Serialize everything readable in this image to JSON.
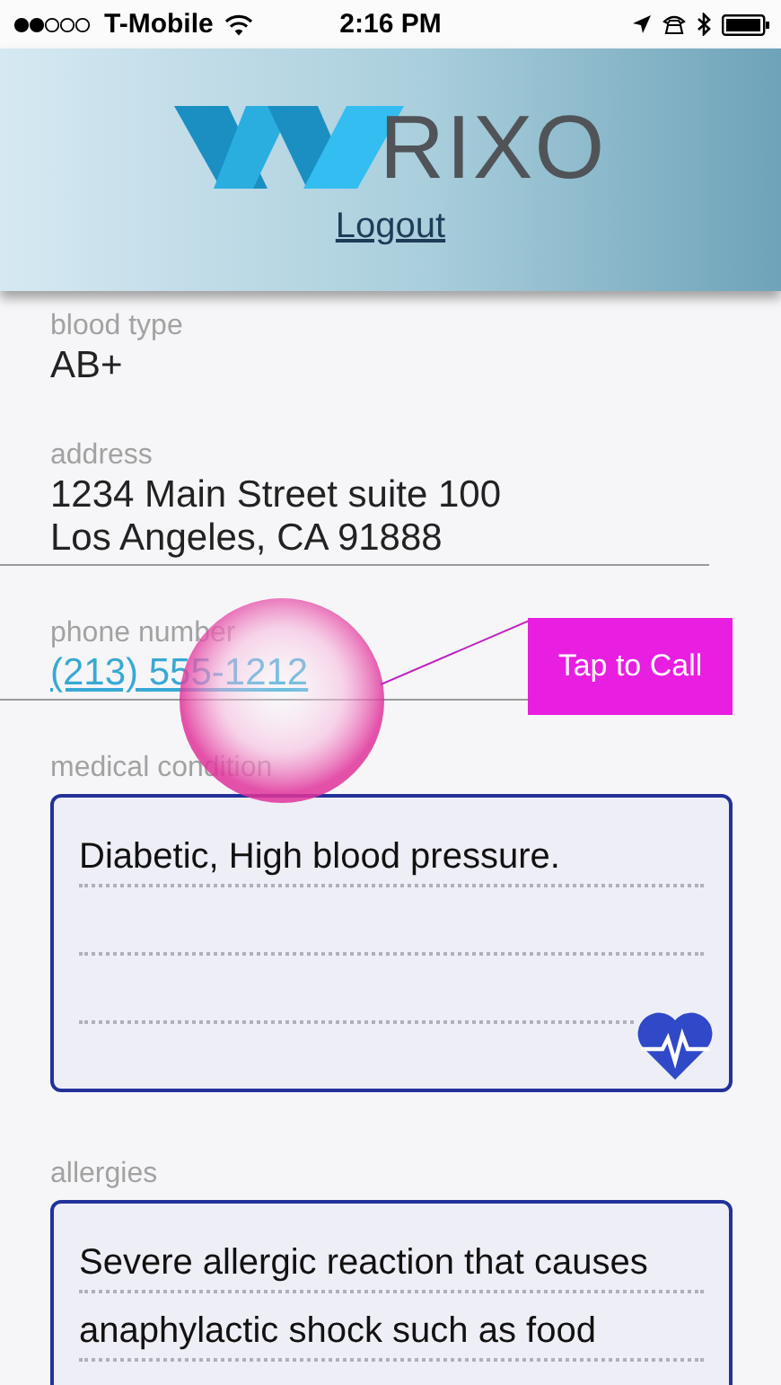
{
  "status_bar": {
    "carrier": "T-Mobile",
    "time": "2:16 PM"
  },
  "header": {
    "logo_text": "RIXO",
    "link": "Logout"
  },
  "fields": [
    {
      "label": "blood type",
      "kind": "text",
      "lines": [
        "AB+"
      ],
      "divider": false
    },
    {
      "label": "address",
      "kind": "text",
      "lines": [
        "1234 Main Street suite 100",
        "Los Angeles, CA 91888"
      ],
      "divider": true
    },
    {
      "label": "phone number",
      "kind": "link",
      "lines": [
        "(213) 555-1212"
      ],
      "divider": true
    },
    {
      "label": "medical condition",
      "kind": "notes",
      "lines": [
        "Diabetic, High blood pressure."
      ],
      "heart_icon": true
    },
    {
      "label": "allergies",
      "kind": "notes",
      "lines": [
        "Severe allergic reaction that causes",
        "anaphylactic shock such as food"
      ]
    }
  ],
  "callout": {
    "text": "Tap to Call"
  }
}
